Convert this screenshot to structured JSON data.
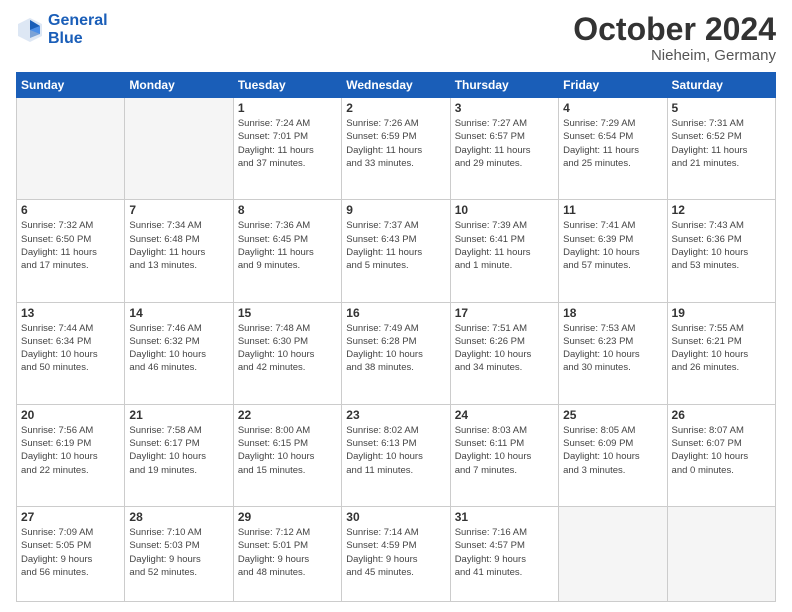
{
  "logo": {
    "line1": "General",
    "line2": "Blue"
  },
  "title": "October 2024",
  "location": "Nieheim, Germany",
  "days_header": [
    "Sunday",
    "Monday",
    "Tuesday",
    "Wednesday",
    "Thursday",
    "Friday",
    "Saturday"
  ],
  "weeks": [
    [
      {
        "num": "",
        "info": ""
      },
      {
        "num": "",
        "info": ""
      },
      {
        "num": "1",
        "info": "Sunrise: 7:24 AM\nSunset: 7:01 PM\nDaylight: 11 hours\nand 37 minutes."
      },
      {
        "num": "2",
        "info": "Sunrise: 7:26 AM\nSunset: 6:59 PM\nDaylight: 11 hours\nand 33 minutes."
      },
      {
        "num": "3",
        "info": "Sunrise: 7:27 AM\nSunset: 6:57 PM\nDaylight: 11 hours\nand 29 minutes."
      },
      {
        "num": "4",
        "info": "Sunrise: 7:29 AM\nSunset: 6:54 PM\nDaylight: 11 hours\nand 25 minutes."
      },
      {
        "num": "5",
        "info": "Sunrise: 7:31 AM\nSunset: 6:52 PM\nDaylight: 11 hours\nand 21 minutes."
      }
    ],
    [
      {
        "num": "6",
        "info": "Sunrise: 7:32 AM\nSunset: 6:50 PM\nDaylight: 11 hours\nand 17 minutes."
      },
      {
        "num": "7",
        "info": "Sunrise: 7:34 AM\nSunset: 6:48 PM\nDaylight: 11 hours\nand 13 minutes."
      },
      {
        "num": "8",
        "info": "Sunrise: 7:36 AM\nSunset: 6:45 PM\nDaylight: 11 hours\nand 9 minutes."
      },
      {
        "num": "9",
        "info": "Sunrise: 7:37 AM\nSunset: 6:43 PM\nDaylight: 11 hours\nand 5 minutes."
      },
      {
        "num": "10",
        "info": "Sunrise: 7:39 AM\nSunset: 6:41 PM\nDaylight: 11 hours\nand 1 minute."
      },
      {
        "num": "11",
        "info": "Sunrise: 7:41 AM\nSunset: 6:39 PM\nDaylight: 10 hours\nand 57 minutes."
      },
      {
        "num": "12",
        "info": "Sunrise: 7:43 AM\nSunset: 6:36 PM\nDaylight: 10 hours\nand 53 minutes."
      }
    ],
    [
      {
        "num": "13",
        "info": "Sunrise: 7:44 AM\nSunset: 6:34 PM\nDaylight: 10 hours\nand 50 minutes."
      },
      {
        "num": "14",
        "info": "Sunrise: 7:46 AM\nSunset: 6:32 PM\nDaylight: 10 hours\nand 46 minutes."
      },
      {
        "num": "15",
        "info": "Sunrise: 7:48 AM\nSunset: 6:30 PM\nDaylight: 10 hours\nand 42 minutes."
      },
      {
        "num": "16",
        "info": "Sunrise: 7:49 AM\nSunset: 6:28 PM\nDaylight: 10 hours\nand 38 minutes."
      },
      {
        "num": "17",
        "info": "Sunrise: 7:51 AM\nSunset: 6:26 PM\nDaylight: 10 hours\nand 34 minutes."
      },
      {
        "num": "18",
        "info": "Sunrise: 7:53 AM\nSunset: 6:23 PM\nDaylight: 10 hours\nand 30 minutes."
      },
      {
        "num": "19",
        "info": "Sunrise: 7:55 AM\nSunset: 6:21 PM\nDaylight: 10 hours\nand 26 minutes."
      }
    ],
    [
      {
        "num": "20",
        "info": "Sunrise: 7:56 AM\nSunset: 6:19 PM\nDaylight: 10 hours\nand 22 minutes."
      },
      {
        "num": "21",
        "info": "Sunrise: 7:58 AM\nSunset: 6:17 PM\nDaylight: 10 hours\nand 19 minutes."
      },
      {
        "num": "22",
        "info": "Sunrise: 8:00 AM\nSunset: 6:15 PM\nDaylight: 10 hours\nand 15 minutes."
      },
      {
        "num": "23",
        "info": "Sunrise: 8:02 AM\nSunset: 6:13 PM\nDaylight: 10 hours\nand 11 minutes."
      },
      {
        "num": "24",
        "info": "Sunrise: 8:03 AM\nSunset: 6:11 PM\nDaylight: 10 hours\nand 7 minutes."
      },
      {
        "num": "25",
        "info": "Sunrise: 8:05 AM\nSunset: 6:09 PM\nDaylight: 10 hours\nand 3 minutes."
      },
      {
        "num": "26",
        "info": "Sunrise: 8:07 AM\nSunset: 6:07 PM\nDaylight: 10 hours\nand 0 minutes."
      }
    ],
    [
      {
        "num": "27",
        "info": "Sunrise: 7:09 AM\nSunset: 5:05 PM\nDaylight: 9 hours\nand 56 minutes."
      },
      {
        "num": "28",
        "info": "Sunrise: 7:10 AM\nSunset: 5:03 PM\nDaylight: 9 hours\nand 52 minutes."
      },
      {
        "num": "29",
        "info": "Sunrise: 7:12 AM\nSunset: 5:01 PM\nDaylight: 9 hours\nand 48 minutes."
      },
      {
        "num": "30",
        "info": "Sunrise: 7:14 AM\nSunset: 4:59 PM\nDaylight: 9 hours\nand 45 minutes."
      },
      {
        "num": "31",
        "info": "Sunrise: 7:16 AM\nSunset: 4:57 PM\nDaylight: 9 hours\nand 41 minutes."
      },
      {
        "num": "",
        "info": ""
      },
      {
        "num": "",
        "info": ""
      }
    ]
  ]
}
